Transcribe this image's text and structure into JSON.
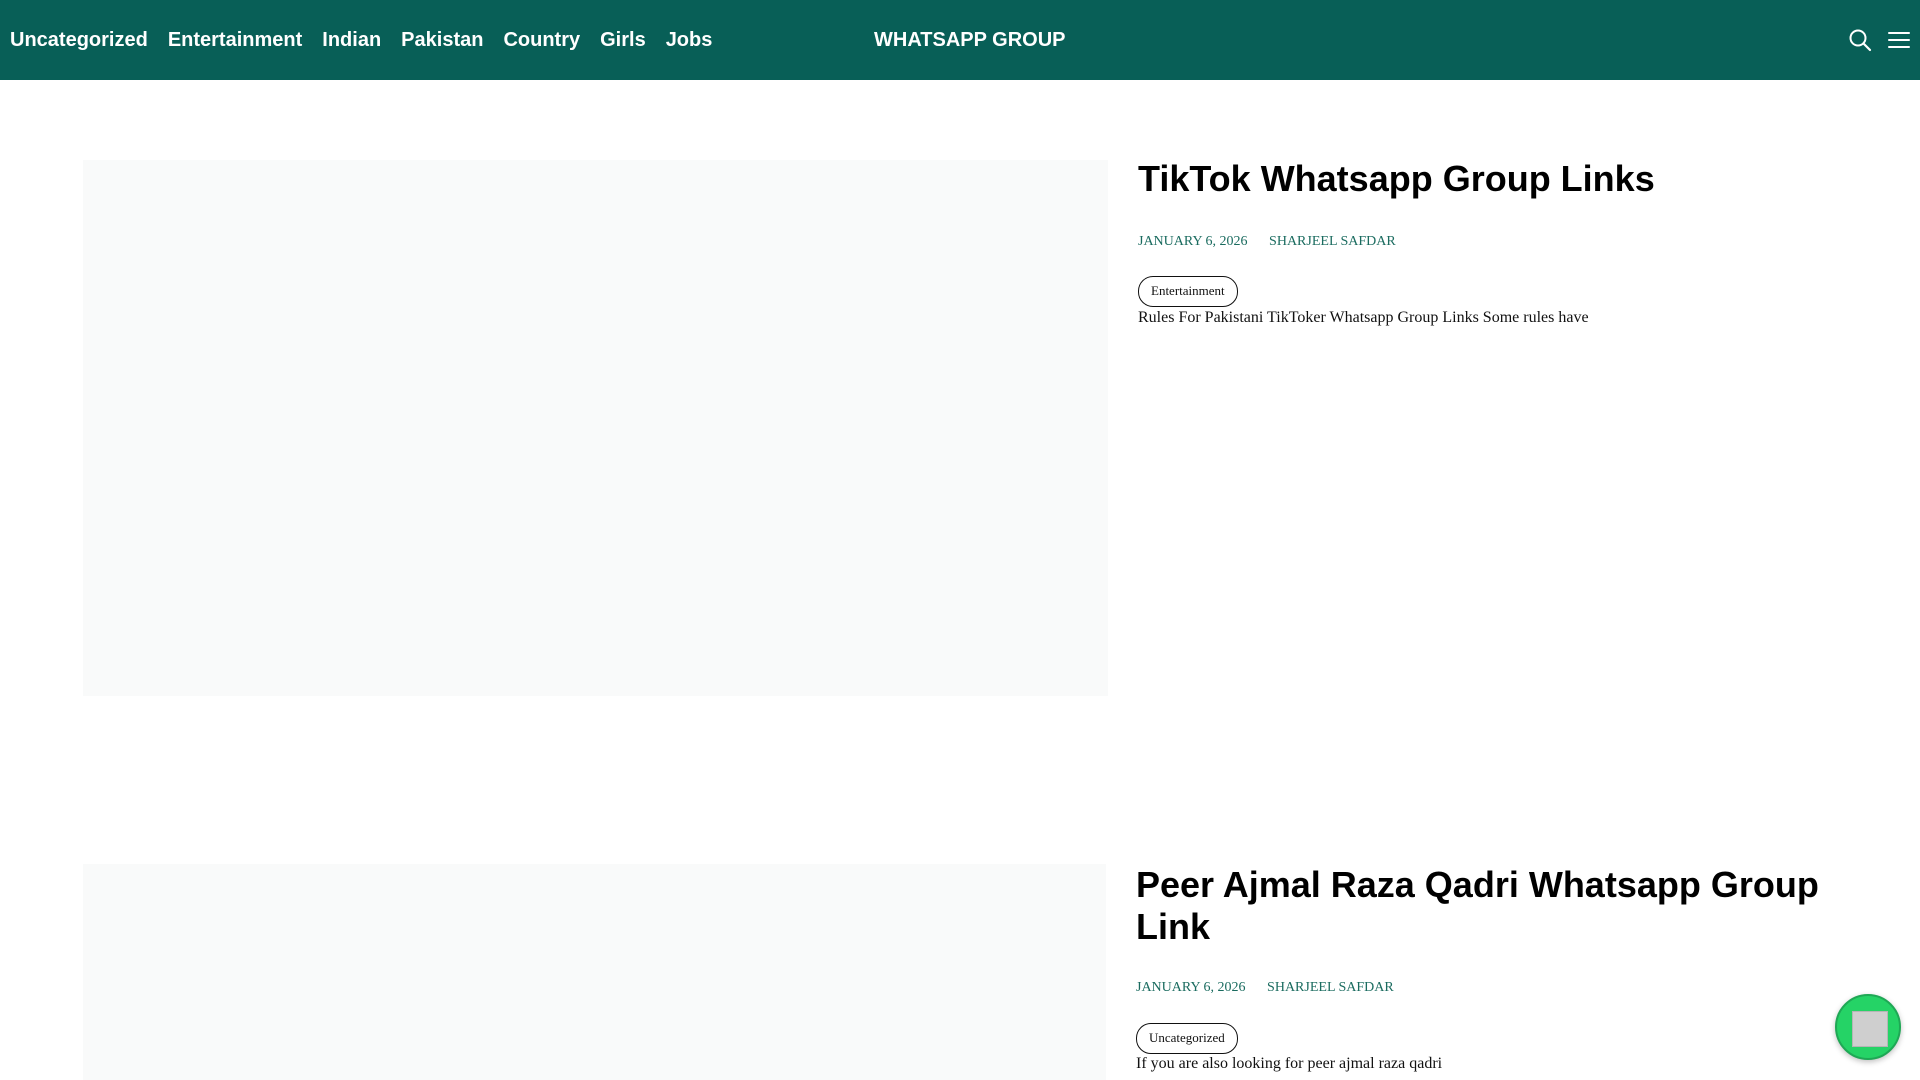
{
  "header": {
    "nav": [
      "Uncategorized",
      "Entertainment",
      "Indian",
      "Pakistan",
      "Country",
      "Girls",
      "Jobs"
    ],
    "brand": "WHATSAPP GROUP",
    "icons": {
      "search": "search-icon",
      "menu": "menu-icon"
    },
    "background": "#085f57"
  },
  "posts": [
    {
      "title": "TikTok Whatsapp Group Links",
      "date": "JANUARY 6, 2026",
      "author": "SHARJEEL SAFDAR",
      "category": "Entertainment",
      "excerpt": "Rules For Pakistani TikToker Whatsapp Group Links Some rules have"
    },
    {
      "title": "Peer Ajmal Raza Qadri Whatsapp Group Link",
      "date": "JANUARY 6, 2026",
      "author": "SHARJEEL SAFDAR",
      "category": "Uncategorized",
      "excerpt": "If you are also looking for peer ajmal raza qadri"
    }
  ],
  "floating_button": {
    "icon": "whatsapp-chat-icon",
    "color": "#25d366"
  }
}
